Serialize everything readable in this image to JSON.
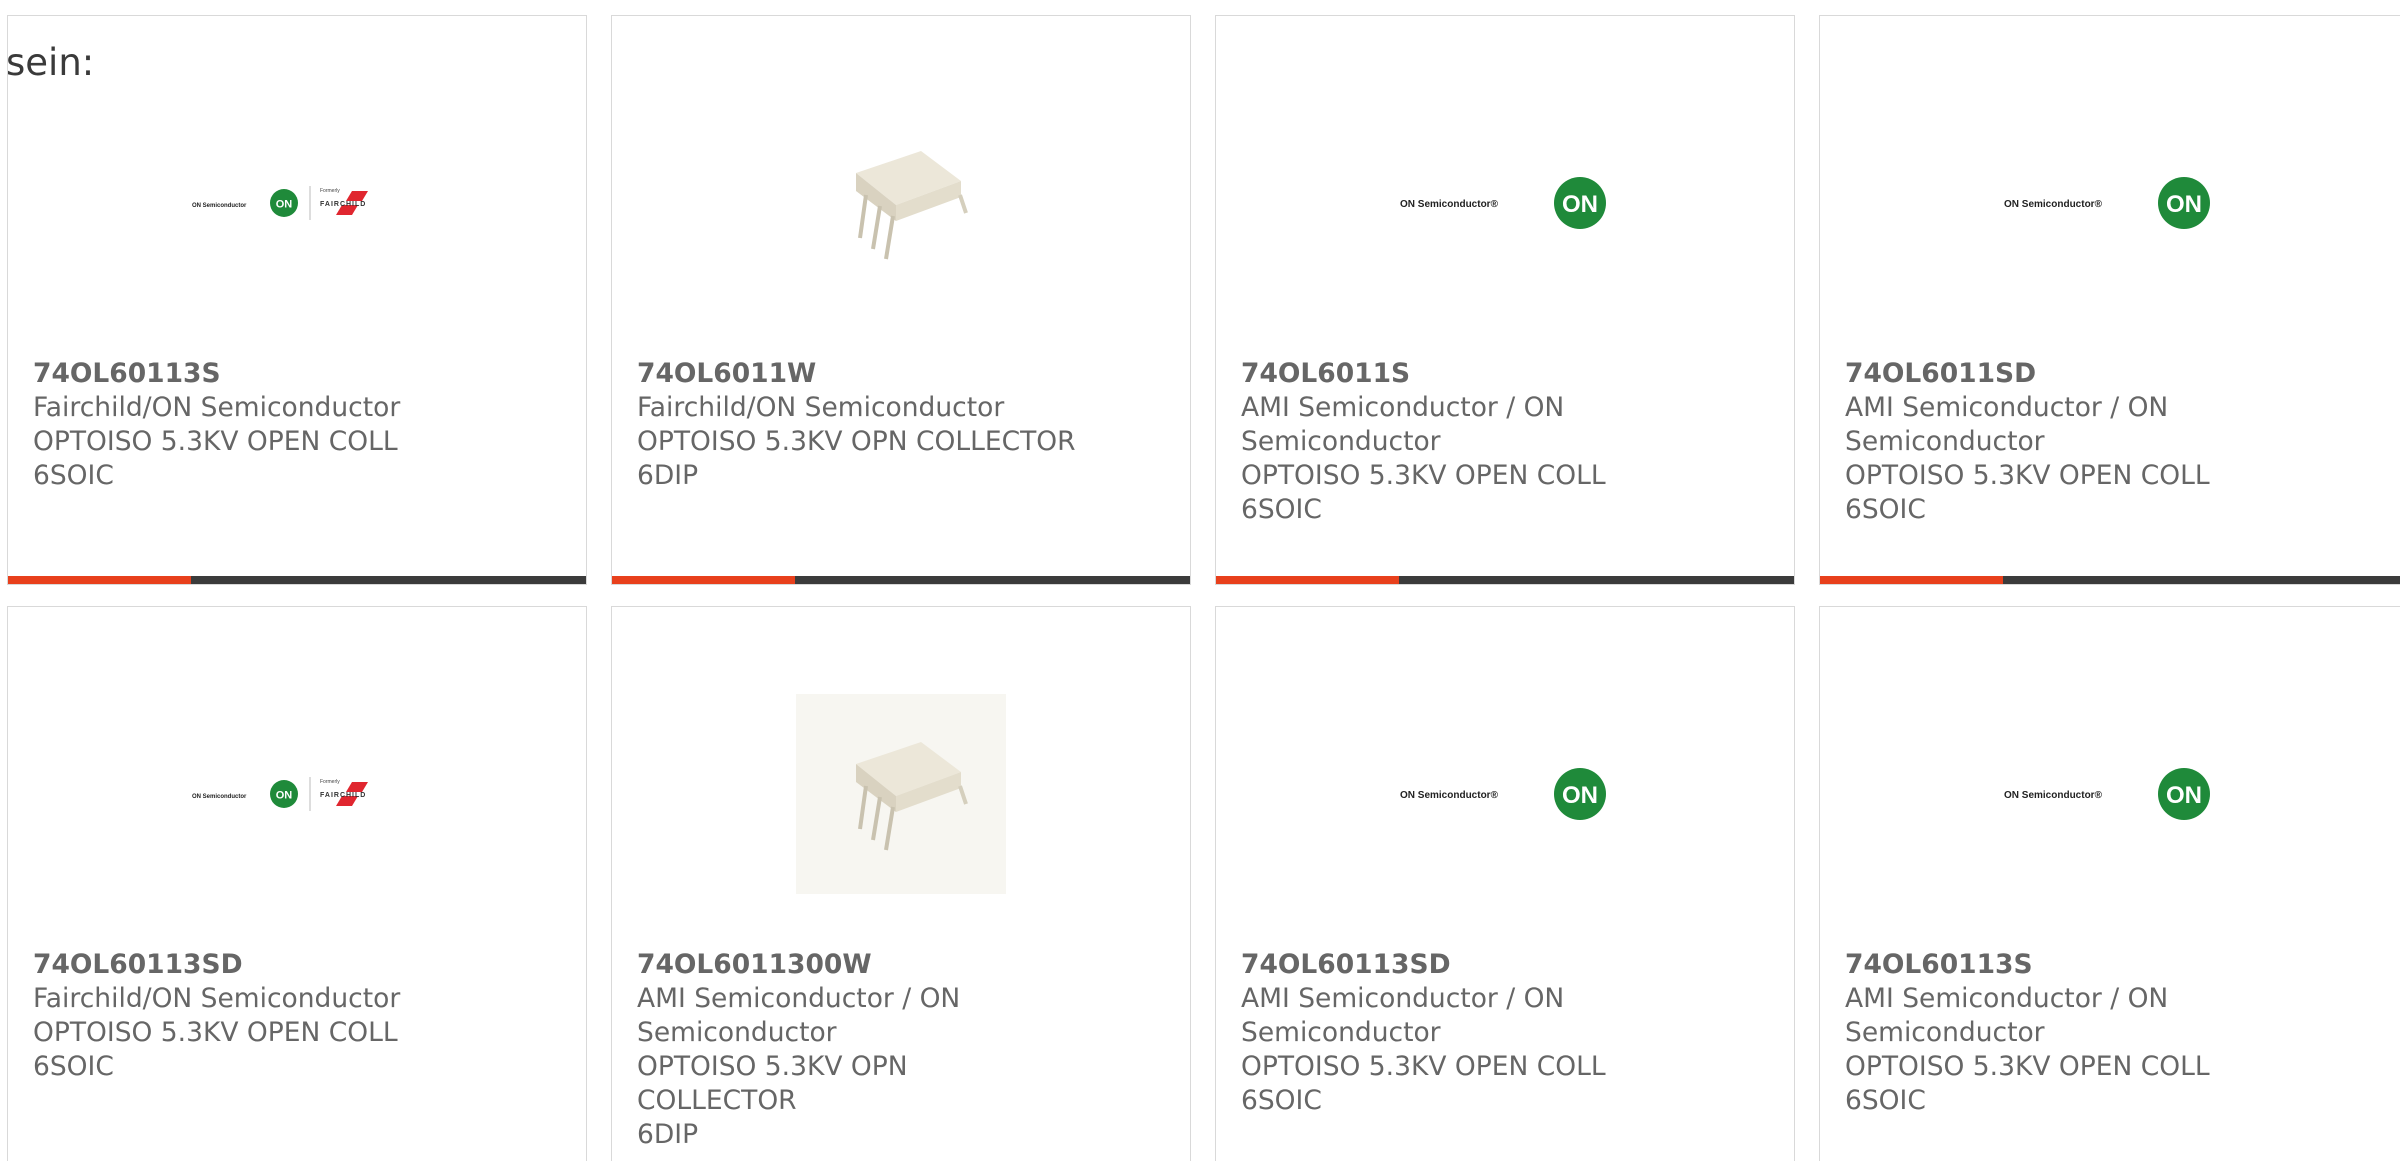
{
  "intro_text": "sein:",
  "accent_color": "#e8401c",
  "bar_color": "#3b3b3b",
  "on_green": "#1f8a3a",
  "fairchild_red": "#e0262f",
  "logos": {
    "on_fairchild": {
      "on_text": "ON Semiconductor",
      "formerly": "Formerly",
      "fairchild": "FAIRCHILD"
    },
    "on": {
      "on_text": "ON Semiconductor®",
      "badge": "ON"
    }
  },
  "products": [
    {
      "part": "74OL60113S",
      "manufacturer": "Fairchild/ON Semiconductor",
      "description": [
        "OPTOISO 5.3KV OPEN COLL",
        "6SOIC"
      ],
      "image": "on-fairchild-logo"
    },
    {
      "part": "74OL6011W",
      "manufacturer": "Fairchild/ON Semiconductor",
      "description": [
        "OPTOISO 5.3KV OPN COLLECTOR",
        "6DIP"
      ],
      "image": "dip6-package"
    },
    {
      "part": "74OL6011S",
      "manufacturer": "AMI Semiconductor / ON Semiconductor",
      "description": [
        "OPTOISO 5.3KV OPEN COLL",
        "6SOIC"
      ],
      "image": "on-semiconductor-logo"
    },
    {
      "part": "74OL6011SD",
      "manufacturer": "AMI Semiconductor / ON Semiconductor",
      "description": [
        "OPTOISO 5.3KV OPEN COLL",
        "6SOIC"
      ],
      "image": "on-semiconductor-logo"
    },
    {
      "part": "74OL60113SD",
      "manufacturer": "Fairchild/ON Semiconductor",
      "description": [
        "OPTOISO 5.3KV OPEN COLL",
        "6SOIC"
      ],
      "image": "on-fairchild-logo"
    },
    {
      "part": "74OL6011300W",
      "manufacturer": "AMI Semiconductor / ON Semiconductor",
      "description": [
        "OPTOISO 5.3KV OPN COLLECTOR",
        "6DIP"
      ],
      "image": "dip6-package-boxed"
    },
    {
      "part": "74OL60113SD",
      "manufacturer": "AMI Semiconductor / ON Semiconductor",
      "description": [
        "OPTOISO 5.3KV OPEN COLL",
        "6SOIC"
      ],
      "image": "on-semiconductor-logo"
    },
    {
      "part": "74OL60113S",
      "manufacturer": "AMI Semiconductor / ON Semiconductor",
      "description": [
        "OPTOISO 5.3KV OPEN COLL",
        "6SOIC"
      ],
      "image": "on-semiconductor-logo"
    }
  ]
}
